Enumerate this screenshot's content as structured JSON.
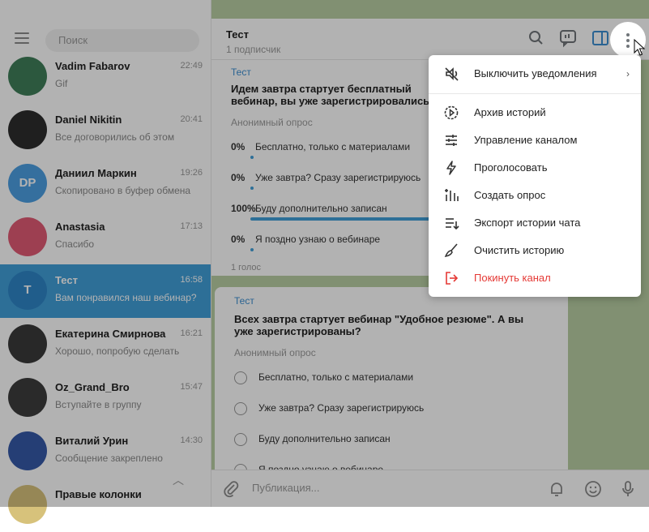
{
  "left": {
    "search_placeholder": "Поиск",
    "chats": [
      {
        "name": "Vadim Fabarov",
        "preview": "Gif",
        "time": "22:49",
        "color": "#3f7f5a",
        "initials": "",
        "active": false
      },
      {
        "name": "Daniel Nikitin",
        "preview": "Все договорились об этом",
        "time": "20:41",
        "color": "#2d2d2d",
        "initials": "",
        "active": false
      },
      {
        "name": "Даниил Маркин",
        "preview": "Скопировано в буфер обмена",
        "time": "19:26",
        "color": "#4d9fe3",
        "initials": "DP",
        "active": false
      },
      {
        "name": "Anastasia",
        "preview": "Спасибо",
        "time": "17:13",
        "color": "#e15b75",
        "initials": "",
        "active": false
      },
      {
        "name": "Тест",
        "preview": "Вам понравился наш вебинар?",
        "time": "16:58",
        "color": "#2f86c8",
        "initials": "T",
        "active": true
      },
      {
        "name": "Екатерина Смирнова",
        "preview": "Хорошо, попробую сделать",
        "time": "16:21",
        "color": "#3a3a3a",
        "initials": "",
        "active": false
      },
      {
        "name": "Oz_Grand_Bro",
        "preview": "Вступайте в группу",
        "time": "15:47",
        "color": "#3d3d3d",
        "initials": "",
        "active": false
      },
      {
        "name": "Виталий Урин",
        "preview": "Сообщение закреплено",
        "time": "14:30",
        "color": "#3659a8",
        "initials": "",
        "active": false
      },
      {
        "name": "Правые колонки",
        "preview": "",
        "time": "",
        "color": "#d7c27b",
        "initials": "",
        "active": false
      }
    ]
  },
  "chat": {
    "title": "Тест",
    "subtitle": "1 подписчик",
    "composer_placeholder": "Публикация...",
    "messages": [
      {
        "author": "Тест",
        "question": "Идем завтра стартует бесплатный вебинар, вы уже зарегистрировались?",
        "kind": "Анонимный опрос",
        "options": [
          {
            "pct": "0%",
            "label": "Бесплатно, только с материалами",
            "fill": 0
          },
          {
            "pct": "0%",
            "label": "Уже завтра? Сразу зарегистрируюсь",
            "fill": 0
          },
          {
            "pct": "100%",
            "label": "Буду дополнительно записан",
            "fill": 1
          },
          {
            "pct": "0%",
            "label": "Я поздно узнаю о вебинаре",
            "fill": 0
          }
        ],
        "votes": "1 голос"
      },
      {
        "author": "Тест",
        "question": "Всех завтра стартует вебинар \"Удобное резюме\". А вы уже зарегистрированы?",
        "kind": "Анонимный опрос",
        "options": [
          {
            "label": "Бесплатно, только с материалами"
          },
          {
            "label": "Уже завтра? Сразу зарегистрируюсь"
          },
          {
            "label": "Буду дополнительно записан"
          },
          {
            "label": "Я поздно узнаю о вебинаре"
          }
        ]
      }
    ]
  },
  "menu": {
    "items": [
      {
        "label": "Выключить уведомления",
        "icon": "mute-icon",
        "submenu": true
      },
      {
        "label": "Архив историй",
        "icon": "story-archive-icon"
      },
      {
        "label": "Управление каналом",
        "icon": "sliders-icon"
      },
      {
        "label": "Проголосовать",
        "icon": "boost-icon"
      },
      {
        "label": "Создать опрос",
        "icon": "poll-icon",
        "highlighted": true
      },
      {
        "label": "Экспорт истории чата",
        "icon": "export-icon"
      },
      {
        "label": "Очистить историю",
        "icon": "broom-icon"
      },
      {
        "label": "Покинуть канал",
        "icon": "leave-icon",
        "danger": true
      }
    ]
  },
  "colors": {
    "accent": "#419fd9",
    "danger": "#e53935",
    "chat_bg": "#b9cfa4"
  }
}
